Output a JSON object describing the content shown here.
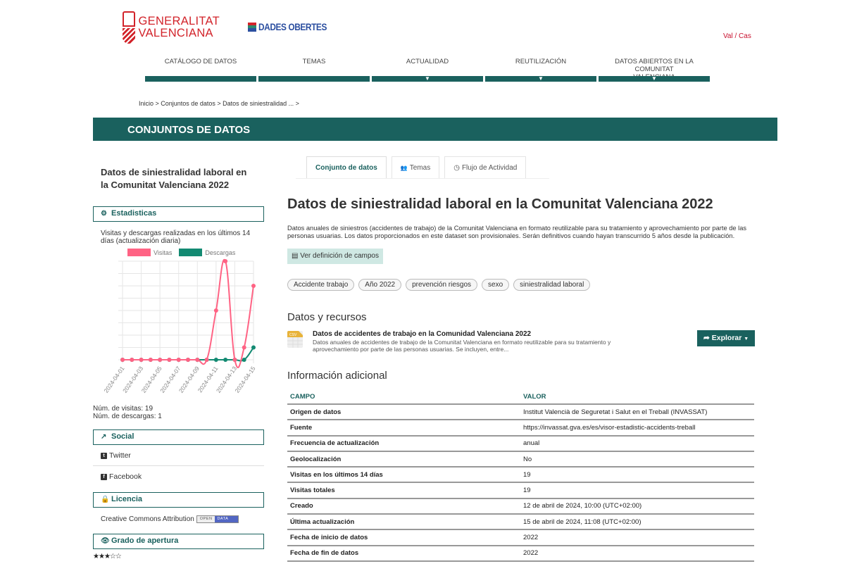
{
  "header": {
    "brand_line1": "GENERALITAT",
    "brand_line2": "VALENCIANA",
    "portal_logo": "DADES OBERTES",
    "language_switch": "Val / Cas",
    "nav": [
      {
        "label": "CATÁLOGO DE DATOS",
        "dropdown": false
      },
      {
        "label": "TEMAS",
        "dropdown": false
      },
      {
        "label": "ACTUALIDAD",
        "dropdown": true
      },
      {
        "label": "REUTILIZACIÓN",
        "dropdown": true
      },
      {
        "label": "DATOS ABIERTOS EN LA COMUNITAT VALENCIANA",
        "dropdown": true
      }
    ],
    "dropdown_glyph": "▼"
  },
  "breadcrumb": {
    "items": [
      "Inicio",
      "Conjuntos de datos",
      "Datos de siniestralidad ..."
    ],
    "separator": " > "
  },
  "banner": {
    "title": "CONJUNTOS DE DATOS"
  },
  "sidebar": {
    "dataset_title": "Datos de siniestralidad laboral en la Comunitat Valenciana 2022",
    "stats_heading": "Estadisticas",
    "stats_description": "Visitas y descargas realizadas en los últimos 14 días (actualización diaria)",
    "visits_count": "Núm. de visitas: 19",
    "downloads_count": "Núm. de descargas: 1",
    "social_heading": "Social",
    "social_links": [
      "Twitter",
      "Facebook"
    ],
    "license_heading": "Licencia",
    "license_text": "Creative Commons Attribution",
    "license_badge": [
      "OPEN",
      "DATA"
    ],
    "openness_heading": "Grado de apertura",
    "openness_rating": 3,
    "openness_max": 5
  },
  "chart_data": {
    "type": "line",
    "title": "",
    "xlabel": "",
    "ylabel": "",
    "x": [
      "2024-04-01",
      "2024-04-02",
      "2024-04-03",
      "2024-04-04",
      "2024-04-05",
      "2024-04-06",
      "2024-04-07",
      "2024-04-08",
      "2024-04-09",
      "2024-04-10",
      "2024-04-11",
      "2024-04-12",
      "2024-04-13",
      "2024-04-14",
      "2024-04-15"
    ],
    "tick_labels": [
      "2024-04-01",
      "2024-04-03",
      "2024-04-05",
      "2024-04-07",
      "2024-04-09",
      "2024-04-11",
      "2024-04-13",
      "2024-04-15"
    ],
    "series": [
      {
        "name": "Visitas",
        "color": "#ff6384",
        "values": [
          0,
          0,
          0,
          0,
          0,
          0,
          0,
          0,
          0,
          0,
          4,
          8,
          0,
          1,
          6
        ]
      },
      {
        "name": "Descargas",
        "color": "#138a72",
        "values": [
          0,
          0,
          0,
          0,
          0,
          0,
          0,
          0,
          0,
          0,
          0,
          0,
          0,
          0,
          1
        ]
      }
    ],
    "ylim": [
      0,
      8
    ],
    "grid": true,
    "legend": "top"
  },
  "tabs": [
    {
      "label": "Conjunto de datos",
      "icon": "",
      "active": true
    },
    {
      "label": "Temas",
      "icon": "👥",
      "active": false
    },
    {
      "label": "Flujo de Actividad",
      "icon": "◷",
      "active": false
    }
  ],
  "dataset": {
    "title": "Datos de siniestralidad laboral en la Comunitat Valenciana 2022",
    "description": "Datos anuales de siniestros (accidentes de trabajo) de la Comunitat Valenciana en formato reutilizable para su tratamiento y aprovechamiento por parte de las personas usuarias. Los datos proporcionados en este dataset son provisionales. Serán definitivos cuando hayan transcurrido 5 años desde la publicación.",
    "fields_button": "Ver definición de campos",
    "tags": [
      "Accidente trabajo",
      "Año 2022",
      "prevención riesgos",
      "sexo",
      "siniestralidad laboral"
    ]
  },
  "resources": {
    "heading": "Datos y recursos",
    "items": [
      {
        "format": "CSV",
        "title": "Datos de accidentes de trabajo en la Comunidad Valenciana 2022",
        "description": "Datos anuales de accidentes de trabajo de la Comunitat Valenciana en formato reutilizable para su tratamiento y aprovechamiento por parte de las personas usuarias. Se incluyen, entre...",
        "explore_label": "Explorar"
      }
    ]
  },
  "additional_info": {
    "heading": "Información adicional",
    "columns": [
      "CAMPO",
      "VALOR"
    ],
    "rows": [
      [
        "Origen de datos",
        "Institut Valencià de Seguretat i Salut en el Treball (INVASSAT)"
      ],
      [
        "Fuente",
        "https://invassat.gva.es/es/visor-estadistic-accidents-treball"
      ],
      [
        "Frecuencia de actualización",
        "anual"
      ],
      [
        "Geolocalización",
        "No"
      ],
      [
        "Visitas en los últimos 14 días",
        "19"
      ],
      [
        "Visitas totales",
        "19"
      ],
      [
        "Creado",
        "12 de abril de 2024, 10:00 (UTC+02:00)"
      ],
      [
        "Última actualización",
        "15 de abril de 2024, 11:08 (UTC+02:00)"
      ],
      [
        "Fecha de inicio de datos",
        "2022"
      ],
      [
        "Fecha de fin de datos",
        "2022"
      ]
    ]
  },
  "colors": {
    "primary": "#1a615e",
    "accent_red": "#d2232a",
    "visits": "#ff6384",
    "downloads": "#138a72",
    "fields_button_bg": "#cfe8e3"
  }
}
